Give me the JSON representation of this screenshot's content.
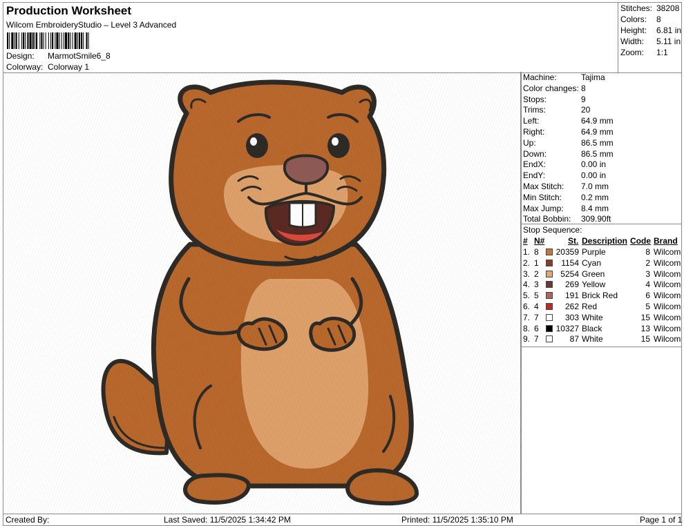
{
  "header": {
    "title": "Production Worksheet",
    "subtitle": "Wilcom EmbroideryStudio – Level 3 Advanced",
    "design_label": "Design:",
    "design_value": "MarmotSmile6_8",
    "colorway_label": "Colorway:",
    "colorway_value": "Colorway 1"
  },
  "stats": [
    {
      "label": "Stitches:",
      "value": "38208"
    },
    {
      "label": "Colors:",
      "value": "8"
    },
    {
      "label": "Height:",
      "value": "6.81 in"
    },
    {
      "label": "Width:",
      "value": "5.11 in"
    },
    {
      "label": "Zoom:",
      "value": "1:1"
    }
  ],
  "machine_info": [
    {
      "label": "Machine:",
      "value": "Tajima"
    },
    {
      "label": "Color changes:",
      "value": "8"
    },
    {
      "label": "Stops:",
      "value": "9"
    },
    {
      "label": "Trims:",
      "value": "20"
    },
    {
      "label": "Left:",
      "value": "64.9 mm"
    },
    {
      "label": "Right:",
      "value": "64.9 mm"
    },
    {
      "label": "Up:",
      "value": "86.5 mm"
    },
    {
      "label": "Down:",
      "value": "86.5 mm"
    },
    {
      "label": "EndX:",
      "value": "0.00 in"
    },
    {
      "label": "EndY:",
      "value": "0.00 in"
    },
    {
      "label": "Max Stitch:",
      "value": "7.0 mm"
    },
    {
      "label": "Min Stitch:",
      "value": "0.2 mm"
    },
    {
      "label": "Max Jump:",
      "value": "8.4 mm"
    },
    {
      "label": "Total Bobbin:",
      "value": "309.90ft"
    }
  ],
  "stop_sequence": {
    "title": "Stop Sequence:",
    "headers": {
      "num": "#",
      "n": "N#",
      "st": "St.",
      "desc": "Description",
      "code": "Code",
      "brand": "Brand"
    },
    "rows": [
      {
        "num": "1.",
        "n": "8",
        "color": "#c8743a",
        "st": "20359",
        "desc": "Purple",
        "code": "8",
        "brand": "Wilcom"
      },
      {
        "num": "2.",
        "n": "1",
        "color": "#8b3f1f",
        "st": "1154",
        "desc": "Cyan",
        "code": "2",
        "brand": "Wilcom"
      },
      {
        "num": "3.",
        "n": "2",
        "color": "#e0a66e",
        "st": "5254",
        "desc": "Green",
        "code": "3",
        "brand": "Wilcom"
      },
      {
        "num": "4.",
        "n": "3",
        "color": "#6b3a36",
        "st": "269",
        "desc": "Yellow",
        "code": "4",
        "brand": "Wilcom"
      },
      {
        "num": "5.",
        "n": "5",
        "color": "#b0645c",
        "st": "191",
        "desc": "Brick Red",
        "code": "6",
        "brand": "Wilcom"
      },
      {
        "num": "6.",
        "n": "4",
        "color": "#c0282a",
        "st": "262",
        "desc": "Red",
        "code": "5",
        "brand": "Wilcom"
      },
      {
        "num": "7.",
        "n": "7",
        "color": "#ffffff",
        "st": "303",
        "desc": "White",
        "code": "15",
        "brand": "Wilcom"
      },
      {
        "num": "8.",
        "n": "6",
        "color": "#000000",
        "st": "10327",
        "desc": "Black",
        "code": "13",
        "brand": "Wilcom"
      },
      {
        "num": "9.",
        "n": "7",
        "color": "#ffffff",
        "st": "87",
        "desc": "White",
        "code": "15",
        "brand": "Wilcom"
      }
    ]
  },
  "footer": {
    "created_by": "Created By:",
    "last_saved": "Last Saved: 11/5/2025 1:34:42 PM",
    "printed": "Printed: 11/5/2025 1:35:10 PM",
    "page": "Page 1 of 1"
  },
  "colors": {
    "fur": "#b8682c",
    "fur_dark": "#9a5322",
    "belly": "#dea06a",
    "outline": "#2e2a26",
    "nose": "#8f5a55",
    "mouth": "#5a2a22",
    "tongue": "#d84a3c",
    "teeth": "#ffffff"
  }
}
